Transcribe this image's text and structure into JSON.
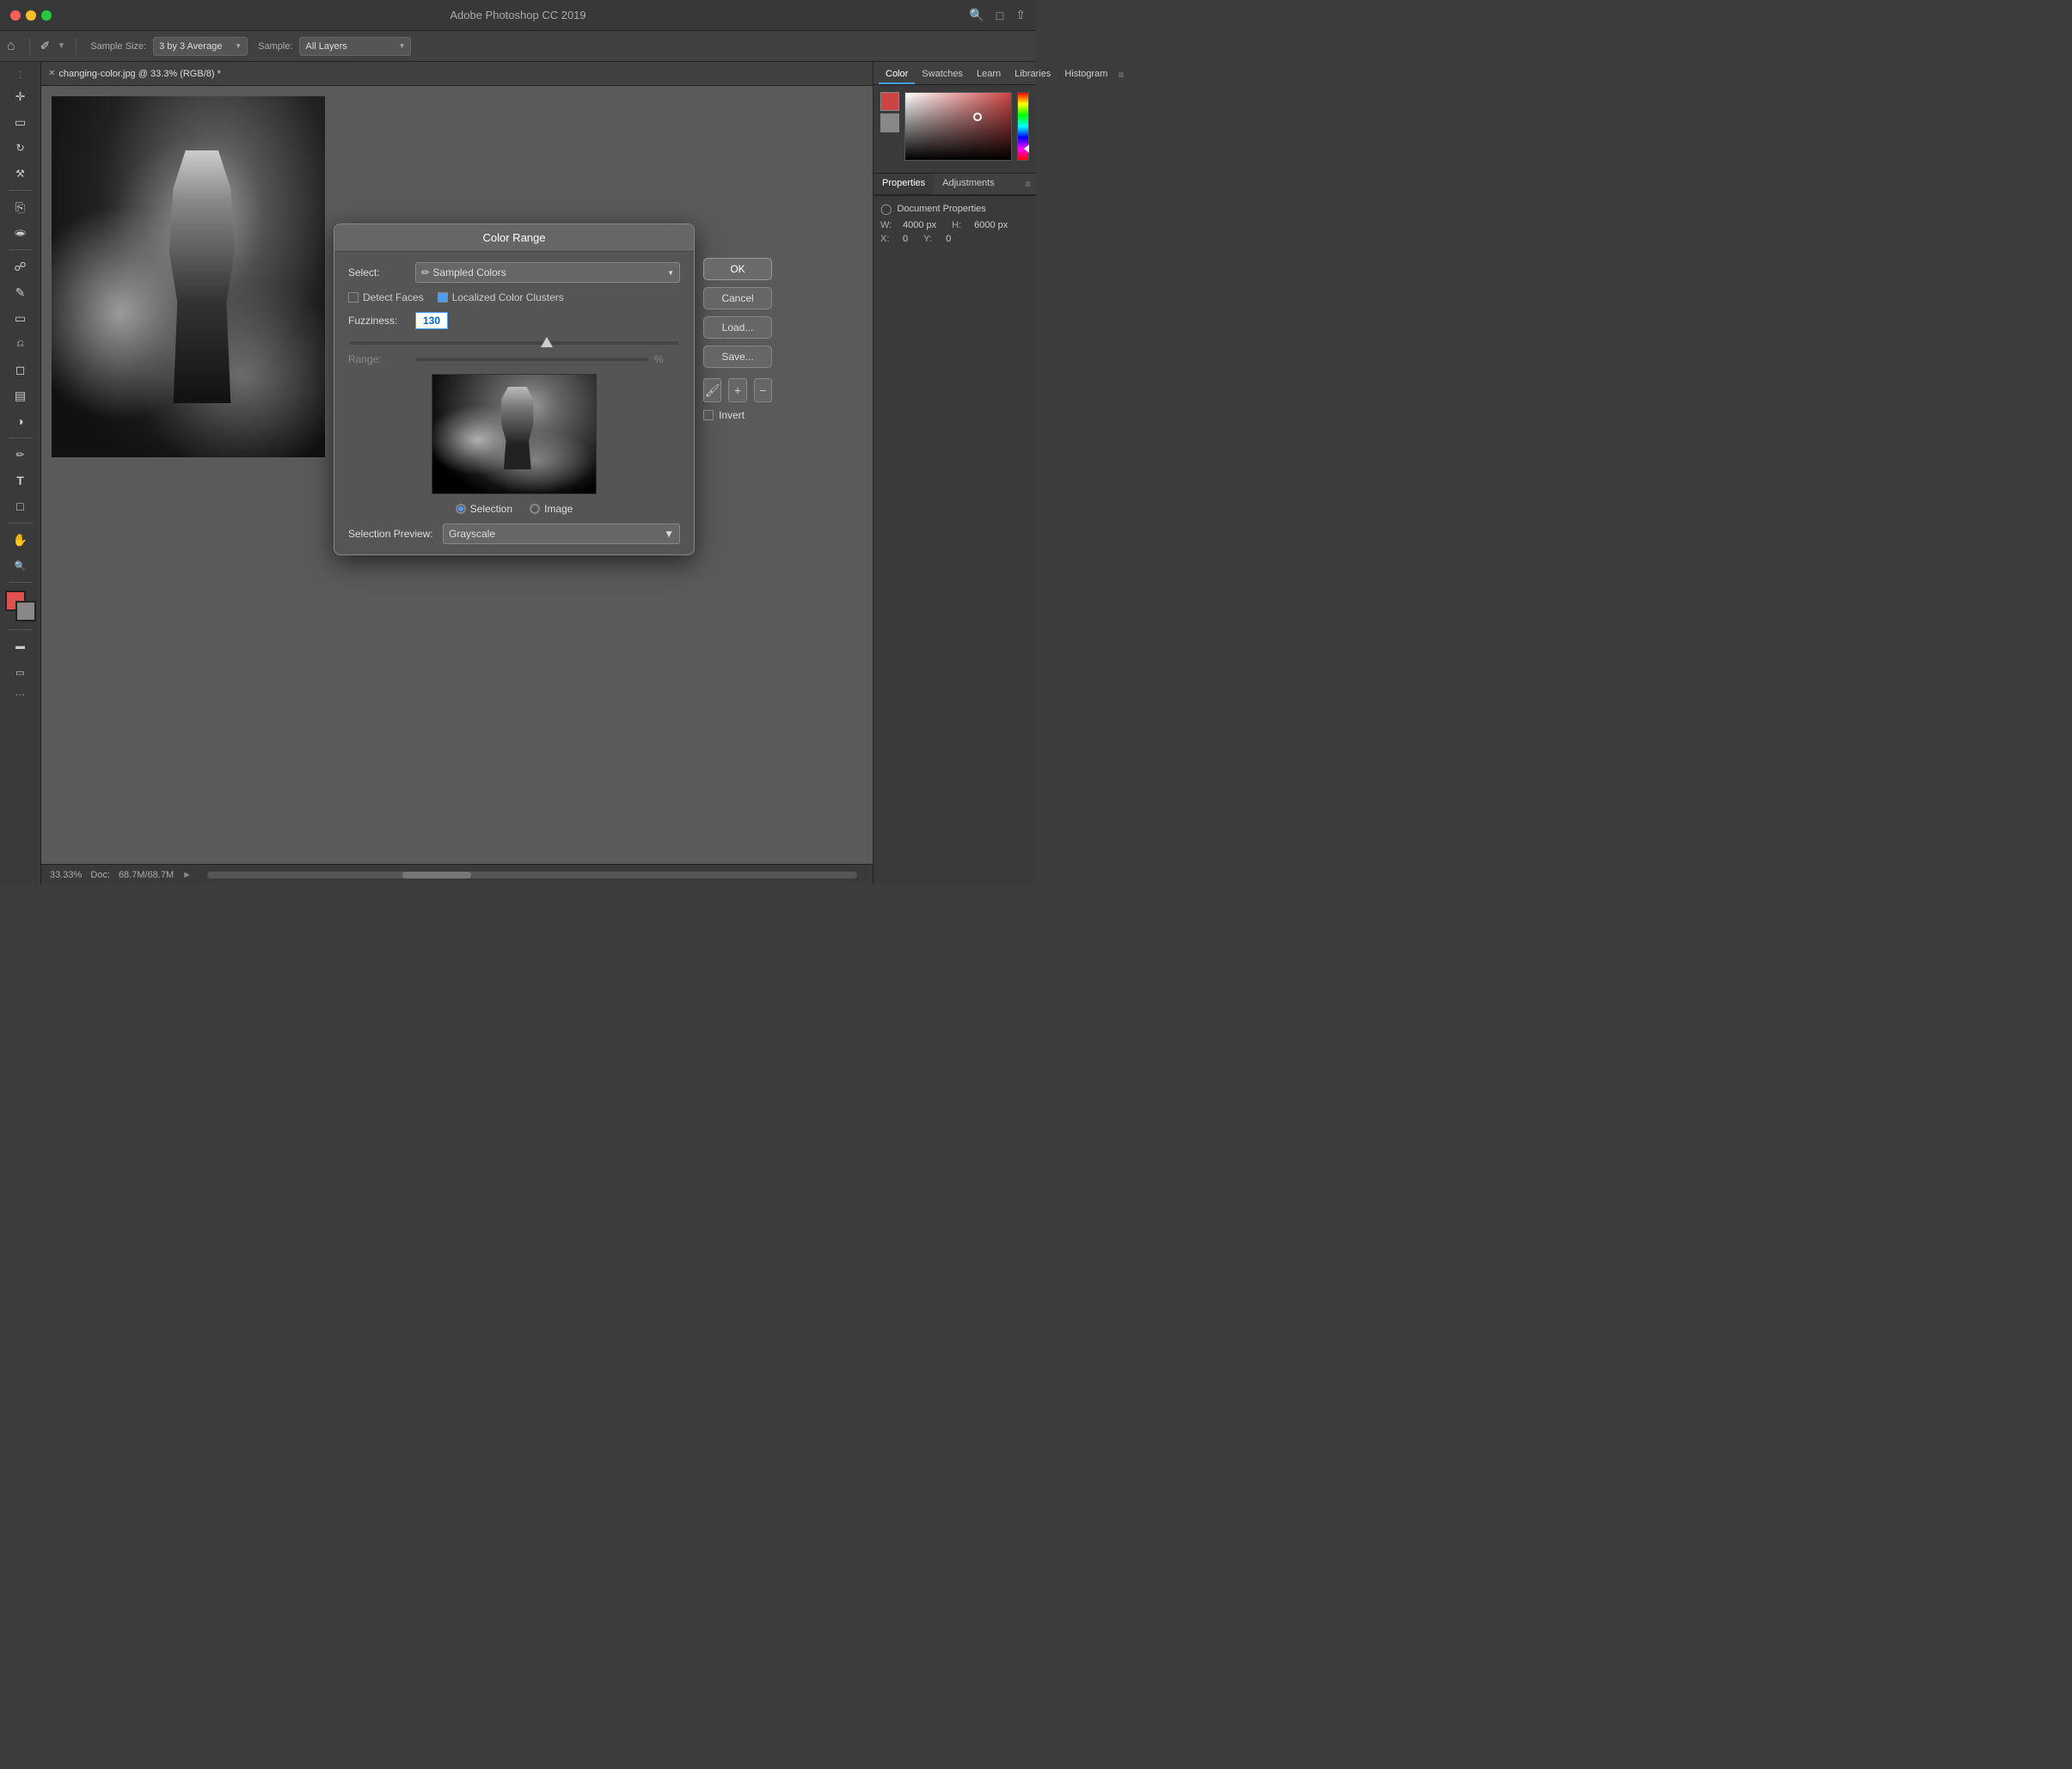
{
  "app": {
    "title": "Adobe Photoshop CC 2019",
    "window_controls": {
      "close": "close",
      "minimize": "minimize",
      "maximize": "maximize"
    }
  },
  "toolbar": {
    "home_label": "⌂",
    "tool_icon": "✏",
    "sample_size_label": "Sample Size:",
    "sample_size_value": "3 by 3 Average",
    "sample_label": "Sample:",
    "sample_value": "All Layers",
    "search_icon": "🔍",
    "layout_icon": "⬜",
    "share_icon": "⬆"
  },
  "tab": {
    "filename": "changing-color.jpg @ 33.3% (RGB/8) *"
  },
  "status_bar": {
    "zoom": "33.33%",
    "doc_label": "Doc:",
    "doc_size": "68.7M/68.7M"
  },
  "right_panel": {
    "tabs": [
      {
        "label": "Color",
        "active": true
      },
      {
        "label": "Swatches",
        "active": false
      },
      {
        "label": "Learn",
        "active": false
      },
      {
        "label": "Libraries",
        "active": false
      },
      {
        "label": "Histogram",
        "active": false
      }
    ],
    "properties_tabs": [
      {
        "label": "Properties",
        "active": true
      },
      {
        "label": "Adjustments",
        "active": false
      }
    ],
    "document_properties_label": "Document Properties",
    "width_label": "W:",
    "width_value": "4000 px",
    "height_label": "H:",
    "height_value": "6000 px",
    "x_label": "X:",
    "x_value": "0",
    "y_label": "Y:",
    "y_value": "0"
  },
  "color_range_dialog": {
    "title": "Color Range",
    "select_label": "Select:",
    "select_value": "✏ Sampled Colors",
    "detect_faces_label": "Detect Faces",
    "detect_faces_checked": false,
    "localized_clusters_label": "Localized Color Clusters",
    "localized_clusters_checked": true,
    "fuzziness_label": "Fuzziness:",
    "fuzziness_value": "130",
    "range_label": "Range:",
    "range_pct": "%",
    "ok_label": "OK",
    "cancel_label": "Cancel",
    "load_label": "Load...",
    "save_label": "Save...",
    "invert_label": "Invert",
    "invert_checked": false,
    "selection_label": "Selection",
    "image_label": "Image",
    "selection_preview_label": "Selection Preview:",
    "selection_preview_value": "Grayscale",
    "eyedroppers": [
      "add_sample",
      "add_to_sample",
      "remove_from_sample"
    ],
    "radio_selection": "selection"
  },
  "left_tools": [
    {
      "name": "move-tool",
      "icon": "✛"
    },
    {
      "name": "marquee-tool",
      "icon": "⬚"
    },
    {
      "name": "lasso-tool",
      "icon": "⌇"
    },
    {
      "name": "magic-wand-tool",
      "icon": "⋯"
    },
    {
      "name": "crop-tool",
      "icon": "⊕"
    },
    {
      "name": "eyedropper-tool",
      "icon": "✒"
    },
    {
      "name": "healing-tool",
      "icon": "⊕"
    },
    {
      "name": "brush-tool",
      "icon": "🖌"
    },
    {
      "name": "clone-tool",
      "icon": "⊗"
    },
    {
      "name": "history-brush-tool",
      "icon": "↺"
    },
    {
      "name": "eraser-tool",
      "icon": "◻"
    },
    {
      "name": "gradient-tool",
      "icon": "▣"
    },
    {
      "name": "dodge-tool",
      "icon": "◑"
    },
    {
      "name": "pen-tool",
      "icon": "✒"
    },
    {
      "name": "type-tool",
      "icon": "T"
    },
    {
      "name": "selection-tool",
      "icon": "⊡"
    },
    {
      "name": "hand-tool",
      "icon": "✋"
    },
    {
      "name": "zoom-tool",
      "icon": "🔍"
    },
    {
      "name": "more-tools",
      "icon": "..."
    }
  ]
}
